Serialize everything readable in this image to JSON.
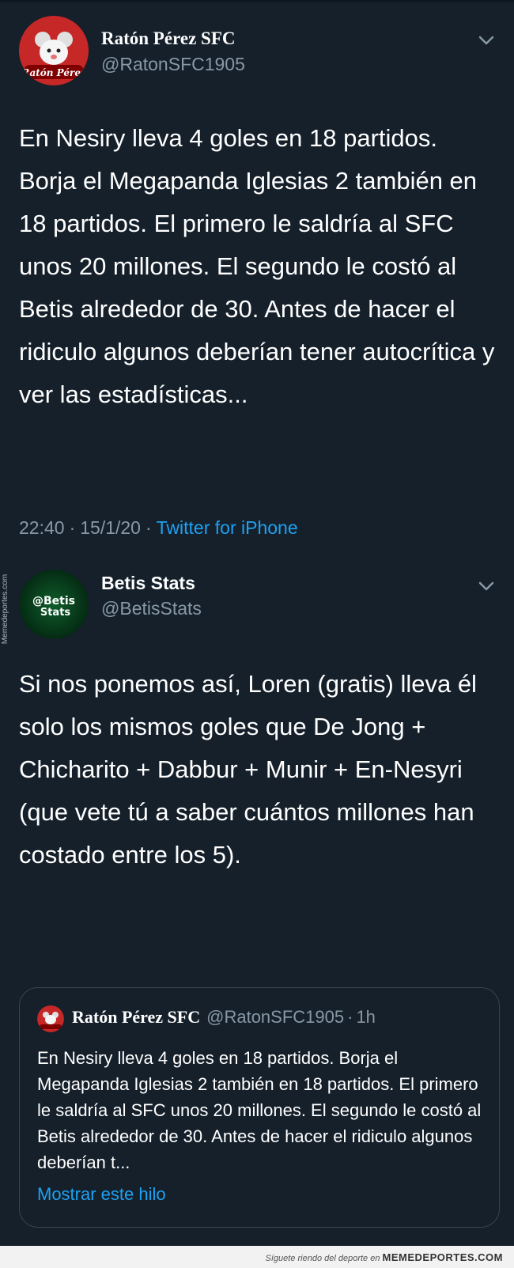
{
  "tweet1": {
    "author_name": "Ratón Pérez SFC",
    "author_handle": "@RatonSFC1905",
    "avatar_text": "Ratón Pérez",
    "text": "En Nesiry lleva 4 goles en 18 partidos. Borja el Megapanda Iglesias 2 también en 18 partidos. El primero le saldría al SFC unos 20 millones. El segundo le costó al Betis alrededor de 30. Antes de hacer el ridiculo algunos deberían tener autocrítica y ver las estadísticas...",
    "time": "22:40",
    "date": "15/1/20",
    "source": "Twitter for iPhone",
    "separator": "·"
  },
  "tweet2": {
    "author_name": "Betis Stats",
    "author_handle": "@BetisStats",
    "avatar_text": "@Betis Stats",
    "text": "Si nos ponemos así, Loren (gratis) lleva él solo los mismos goles que De Jong + Chicharito + Dabbur + Munir + En-Nesyri (que vete tú a saber cuántos millones han costado entre los 5)."
  },
  "quoted_tweet": {
    "author_name": "Ratón Pérez SFC",
    "author_handle": "@RatonSFC1905",
    "separator": "·",
    "age": "1h",
    "text": "En Nesiry lleva 4 goles en 18 partidos. Borja el Megapanda Iglesias 2 también en 18 partidos. El primero le saldría al SFC unos 20 millones. El segundo le costó al Betis alrededor de 30. Antes de hacer el ridiculo algunos deberían t...",
    "show_thread": "Mostrar este hilo"
  },
  "watermark": {
    "side_text": "Memedeportes.com",
    "footer_text": "Síguete riendo del deporte en",
    "footer_brand": "MEMEDEPORTES.COM"
  },
  "colors": {
    "background": "#15202b",
    "secondary_text": "#8899a6",
    "link": "#1da1f2",
    "border": "#38444d"
  },
  "icons": {
    "more": "chevron-down-icon"
  }
}
